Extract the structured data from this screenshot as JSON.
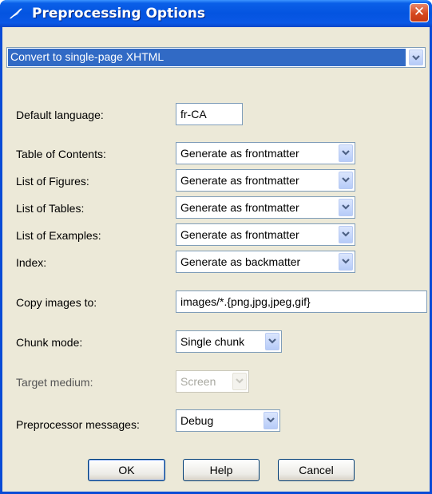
{
  "window": {
    "title": "Preprocessing Options",
    "close_symbol": "✕"
  },
  "conversion": {
    "selected": "Convert to single-page XHTML"
  },
  "fields": {
    "default_language": {
      "label": "Default language:",
      "value": "fr-CA"
    },
    "toc": {
      "label": "Table of Contents:",
      "value": "Generate as frontmatter"
    },
    "figures": {
      "label": "List of Figures:",
      "value": "Generate as frontmatter"
    },
    "tables": {
      "label": "List of Tables:",
      "value": "Generate as frontmatter"
    },
    "examples": {
      "label": "List of Examples:",
      "value": "Generate as frontmatter"
    },
    "index": {
      "label": "Index:",
      "value": "Generate as backmatter"
    },
    "copy_images": {
      "label": "Copy images to:",
      "value": "images/*.{png,jpg,jpeg,gif}"
    },
    "chunk_mode": {
      "label": "Chunk mode:",
      "value": "Single chunk"
    },
    "target_medium": {
      "label": "Target medium:",
      "value": "Screen",
      "enabled": false
    },
    "messages": {
      "label": "Preprocessor messages:",
      "value": "Debug"
    }
  },
  "buttons": {
    "ok": "OK",
    "help": "Help",
    "cancel": "Cancel"
  },
  "colors": {
    "titlebar": "#0454e0",
    "selection": "#316ac5",
    "dialog_bg": "#ece9d8",
    "close": "#d6481f"
  }
}
